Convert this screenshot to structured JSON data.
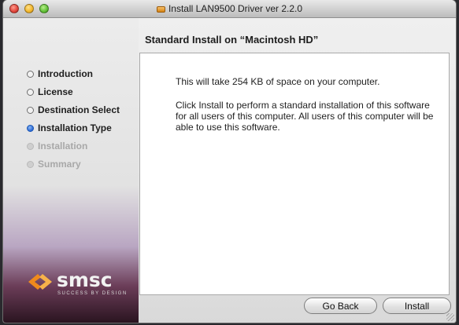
{
  "window": {
    "title": "Install LAN9500 Driver ver 2.2.0",
    "icon": "package-installer-icon"
  },
  "heading": "Standard Install on “Macintosh HD”",
  "steps": [
    {
      "label": "Introduction",
      "state": "done"
    },
    {
      "label": "License",
      "state": "done"
    },
    {
      "label": "Destination Select",
      "state": "done"
    },
    {
      "label": "Installation Type",
      "state": "current"
    },
    {
      "label": "Installation",
      "state": "pending"
    },
    {
      "label": "Summary",
      "state": "pending"
    }
  ],
  "panel": {
    "space_text": "This will take 254 KB of space on your computer.",
    "info_text": "Click Install to perform a standard installation of this software for all users of this computer. All users of this computer will be able to use this software."
  },
  "logo": {
    "name": "smsc",
    "tagline": "SUCCESS BY DESIGN"
  },
  "buttons": {
    "go_back": "Go Back",
    "install": "Install"
  },
  "colors": {
    "accent": "#2e6bd6",
    "logo_orange": "#f08a1c"
  }
}
